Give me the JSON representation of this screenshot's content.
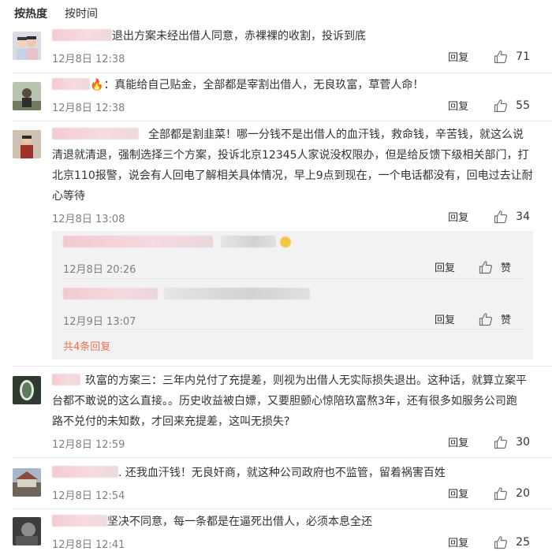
{
  "sort": {
    "hot": "按热度",
    "time": "按时间"
  },
  "reply_label": "回复",
  "like_label": "赞",
  "comments": [
    {
      "text": "退出方案未经出借人同意，赤裸裸的收割，投诉到底",
      "time": "12月8日 12:38",
      "likes": "71"
    },
    {
      "text": "：真能给自己贴金，全部都是宰割出借人，无良玖富，草菅人命！",
      "time": "12月8日 12:38",
      "likes": "55"
    },
    {
      "line1": "全部都是割韭菜！哪一分钱不是出借人的血汗钱，救命钱，辛苦钱，就这么说",
      "line2": "清退就清退，强制选择三个方案，投诉北京12345人家说没权限办，但是给反馈下级相关部门，打",
      "line3": "北京110报警，说会有人回电了解相关具体情况，早上9点到现在，一个电话都没有，回电过去让耐",
      "line4": "心等待",
      "time": "12月8日 13:08",
      "likes": "34"
    },
    {
      "line1": "玖富的方案三：三年内兑付了充提差，则视为出借人无实际损失退出。这种话，就算立案平",
      "line2": "台都不敢说的这么直接。。历史收益被白嫖，又要胆颤心惊陪玖富熬3年，还有很多如服务公司跑",
      "line3": "路不兑付的未知数，才回来充提差，这叫无损失?",
      "time": "12月8日 12:59",
      "likes": "30"
    },
    {
      "text": ". 还我血汗钱！无良奸商，就这种公司政府也不监管，留着祸害百姓",
      "time": "12月8日 12:54",
      "likes": "20"
    },
    {
      "text": "坚决不同意，每一条都是在逼死出借人，必须本息全还",
      "time": "12月8日 12:41",
      "likes": "25"
    }
  ],
  "sub_replies": [
    {
      "time": "12月8日 20:26"
    },
    {
      "time": "12月9日 13:07"
    }
  ],
  "more_replies": "共4条回复"
}
